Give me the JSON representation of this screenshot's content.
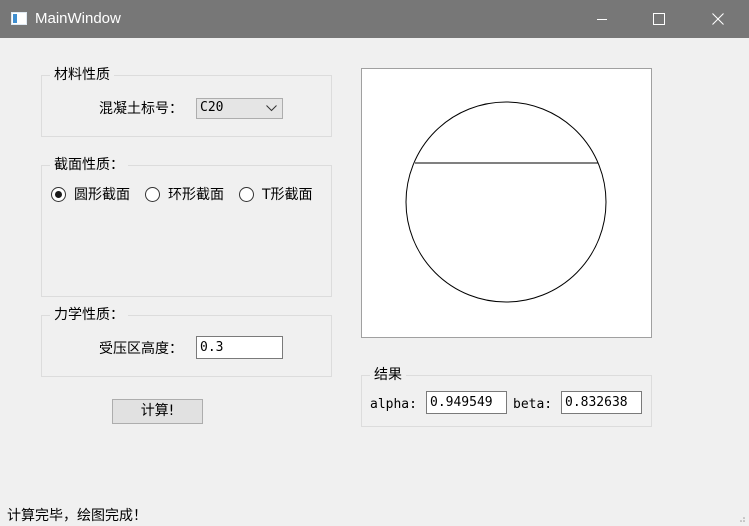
{
  "window": {
    "title": "MainWindow",
    "minimize_icon": "minimize-icon",
    "maximize_icon": "maximize-icon",
    "close_icon": "close-icon"
  },
  "material": {
    "group_title": "材料性质",
    "concrete_label": "混凝土标号：",
    "concrete_grade": "C20"
  },
  "section": {
    "group_title": "截面性质：",
    "options": [
      "圆形截面",
      "环形截面",
      "T形截面"
    ],
    "selected_index": 0
  },
  "mechanics": {
    "group_title": "力学性质：",
    "height_label": "受压区高度：",
    "height_value": "0.3"
  },
  "compute_button": "计算!",
  "results": {
    "group_title": "结果",
    "alpha_label": "alpha:",
    "alpha_value": "0.949549",
    "beta_label": "beta:",
    "beta_value": "0.832638"
  },
  "status": "计算完毕，绘图完成！"
}
